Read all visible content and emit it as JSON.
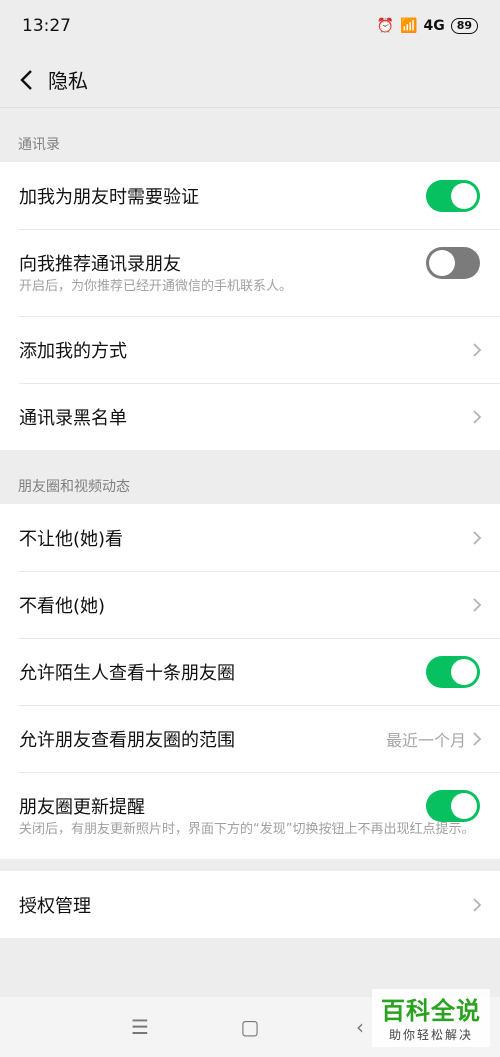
{
  "status_bar": {
    "time": "13:27",
    "network": "4G",
    "battery": "89"
  },
  "header": {
    "title": "隐私"
  },
  "sections": [
    {
      "title": "通讯录",
      "rows": [
        {
          "label": "加我为朋友时需要验证",
          "toggle": "on"
        },
        {
          "label": "向我推荐通讯录朋友",
          "toggle": "off",
          "desc": "开启后，为你推荐已经开通微信的手机联系人。"
        },
        {
          "label": "添加我的方式"
        },
        {
          "label": "通讯录黑名单"
        }
      ]
    },
    {
      "title": "朋友圈和视频动态",
      "rows": [
        {
          "label": "不让他(她)看"
        },
        {
          "label": "不看他(她)"
        },
        {
          "label": "允许陌生人查看十条朋友圈",
          "toggle": "on"
        },
        {
          "label": "允许朋友查看朋友圈的范围",
          "value": "最近一个月"
        },
        {
          "label": "朋友圈更新提醒",
          "toggle": "on",
          "desc": "关闭后，有朋友更新照片时，界面下方的“发现”切换按钮上不再出现红点提示。"
        }
      ]
    }
  ],
  "auth": {
    "label": "授权管理"
  },
  "watermark": {
    "main": "百科全说",
    "sub": "助你轻松解决"
  },
  "colors": {
    "accent": "#07c160",
    "toggle_off": "#7b7b7b",
    "background": "#ededed"
  }
}
